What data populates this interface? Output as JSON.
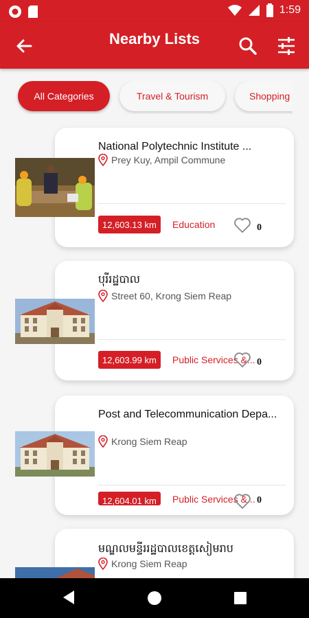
{
  "status_bar": {
    "time": "1:59"
  },
  "header": {
    "title": "Nearby Lists"
  },
  "categories": [
    {
      "label": "All Categories",
      "active": true
    },
    {
      "label": "Travel & Tourism",
      "active": false
    },
    {
      "label": "Shopping",
      "active": false
    }
  ],
  "listings": [
    {
      "name": "National Polytechnic Institute ...",
      "location": "Prey Kuy, Ampil Commune",
      "distance": "12,603.13 km",
      "category": "Education",
      "likes": "0"
    },
    {
      "name": "បុរីរដ្ឋបាល",
      "location": "Street 60, Krong Siem Reap",
      "distance": "12,603.99 km",
      "category": "Public Services &...",
      "likes": "0"
    },
    {
      "name": "Post and Telecommunication Depa...",
      "location": "Krong Siem Reap",
      "distance": "12,604.01 km",
      "category": "Public Services &...",
      "likes": "0"
    },
    {
      "name": "មណ្ឌលមន្ទីររដ្ឋបាលខេត្តសៀមរាប",
      "location": "Krong Siem Reap"
    }
  ],
  "colors": {
    "brand": "#d41f26",
    "background": "#f5f5f5"
  },
  "icons": [
    "back-arrow-icon",
    "search-icon",
    "tune-icon",
    "location-pin-icon",
    "heart-icon"
  ]
}
